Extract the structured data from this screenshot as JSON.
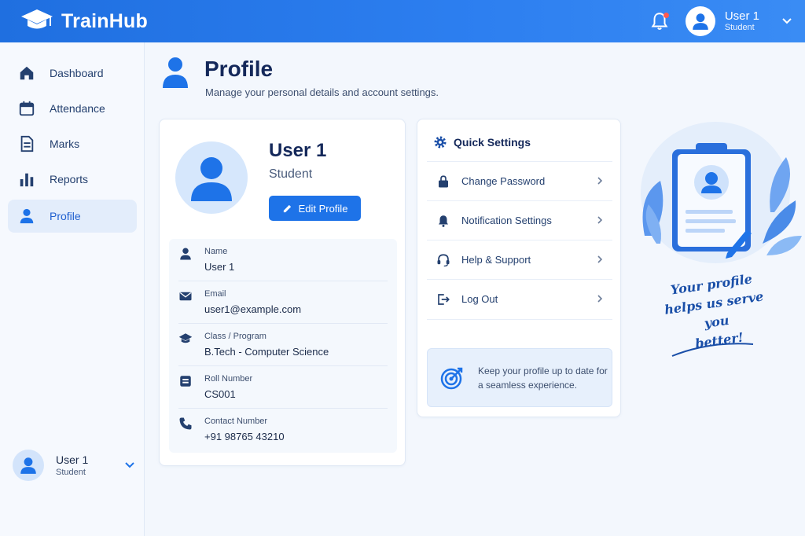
{
  "app": {
    "name": "TrainHub"
  },
  "header": {
    "user_name": "User 1",
    "user_role": "Student",
    "icons": {
      "logo": "graduation-cap-icon",
      "bell": "bell-icon",
      "menu": "chevron-down-icon"
    }
  },
  "sidebar": {
    "items": [
      {
        "label": "Dashboard",
        "icon": "home-icon",
        "active": false
      },
      {
        "label": "Attendance",
        "icon": "calendar-icon",
        "active": false
      },
      {
        "label": "Marks",
        "icon": "document-icon",
        "active": false
      },
      {
        "label": "Reports",
        "icon": "bar-chart-icon",
        "active": false
      },
      {
        "label": "Profile",
        "icon": "user-icon",
        "active": true
      }
    ],
    "user": {
      "name": "User 1",
      "role": "Student"
    }
  },
  "page": {
    "title": "Profile",
    "subtitle": "Manage your personal details and account settings."
  },
  "profile": {
    "name": "User 1",
    "role": "Student",
    "edit_label": "Edit Profile",
    "details": [
      {
        "label": "Name",
        "value": "User 1",
        "icon": "user-icon"
      },
      {
        "label": "Email",
        "value": "user1@example.com",
        "icon": "mail-icon"
      },
      {
        "label": "Class / Program",
        "value": "B.Tech - Computer Science",
        "icon": "graduation-cap-icon"
      },
      {
        "label": "Roll Number",
        "value": "CS001",
        "icon": "id-card-icon"
      },
      {
        "label": "Contact Number",
        "value": "+91 98765 43210",
        "icon": "phone-icon"
      }
    ]
  },
  "quick_settings": {
    "title": "Quick Settings",
    "items": [
      {
        "label": "Change Password",
        "icon": "lock-icon"
      },
      {
        "label": "Notification Settings",
        "icon": "bell-icon"
      },
      {
        "label": "Help & Support",
        "icon": "headset-icon"
      },
      {
        "label": "Log Out",
        "icon": "logout-icon"
      }
    ],
    "tip": "Keep your profile up to date for a seamless experience."
  },
  "illustration": {
    "tagline_lines": [
      "Your profile",
      "helps us serve you",
      "better!"
    ]
  },
  "colors": {
    "primary": "#1e73e8",
    "header": "#2d7ff0",
    "accent_text": "#14285a",
    "notification_dot": "#ff5a4e"
  }
}
